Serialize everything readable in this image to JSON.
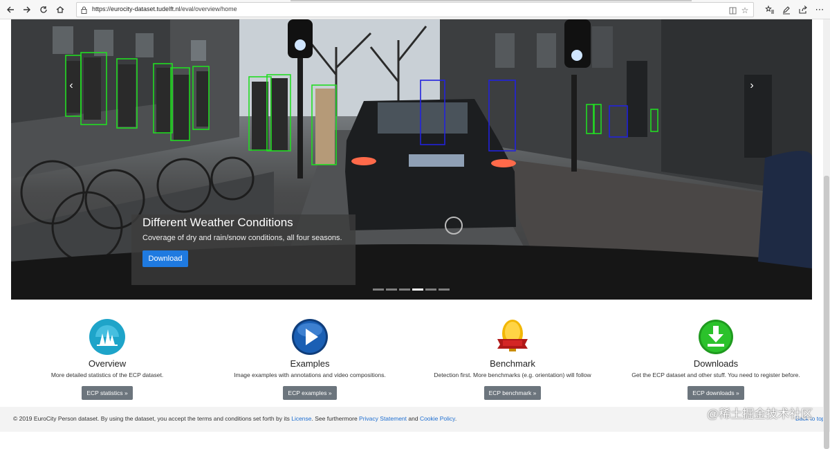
{
  "browser": {
    "url_host": "https://eurocity-dataset.tudelft.nl",
    "url_path": "/eval/overview/home",
    "icons": [
      "back-icon",
      "forward-icon",
      "refresh-icon",
      "home-icon",
      "lock-icon",
      "reading-view-icon",
      "favorite-star-icon",
      "favorites-icon",
      "pen-icon",
      "share-icon",
      "more-icon"
    ]
  },
  "hero": {
    "caption_title": "Different Weather Conditions",
    "caption_subtitle": "Coverage of dry and rain/snow conditions, all four seasons.",
    "download_label": "Download",
    "prev_arrow": "‹",
    "next_arrow": "›",
    "slide_count": 6,
    "active_slide": 4,
    "annotation_colors": {
      "pedestrian": "#22dd22",
      "rider": "#2222dd"
    }
  },
  "features": [
    {
      "title": "Overview",
      "description": "More detailed statistics of the ECP dataset.",
      "button": "ECP statistics »",
      "icon": "overview-icon",
      "color": "#1ea4c9"
    },
    {
      "title": "Examples",
      "description": "Image examples with annotations and video compositions.",
      "button": "ECP examples »",
      "icon": "play-icon",
      "color": "#1a5fb4"
    },
    {
      "title": "Benchmark",
      "description": "Detection first. More benchmarks (e.g. orientation) will follow",
      "button": "ECP benchmark »",
      "icon": "medal-icon",
      "color": "#e0a500"
    },
    {
      "title": "Downloads",
      "description": "Get the ECP dataset and other stuff. You need to register before.",
      "button": "ECP downloads »",
      "icon": "download-icon",
      "color": "#22b522"
    }
  ],
  "footer": {
    "text_prefix": "© 2019 EuroCity Person dataset. By using the dataset, you accept the terms and conditions set forth by its ",
    "license_link": "License",
    "text_middle": ". See furthermore ",
    "privacy_link": "Privacy Statement",
    "text_and": " and ",
    "cookie_link": "Cookie Policy",
    "text_end": ".",
    "back_to_top": "Back to top"
  },
  "watermark": "@稀土掘金技术社区"
}
